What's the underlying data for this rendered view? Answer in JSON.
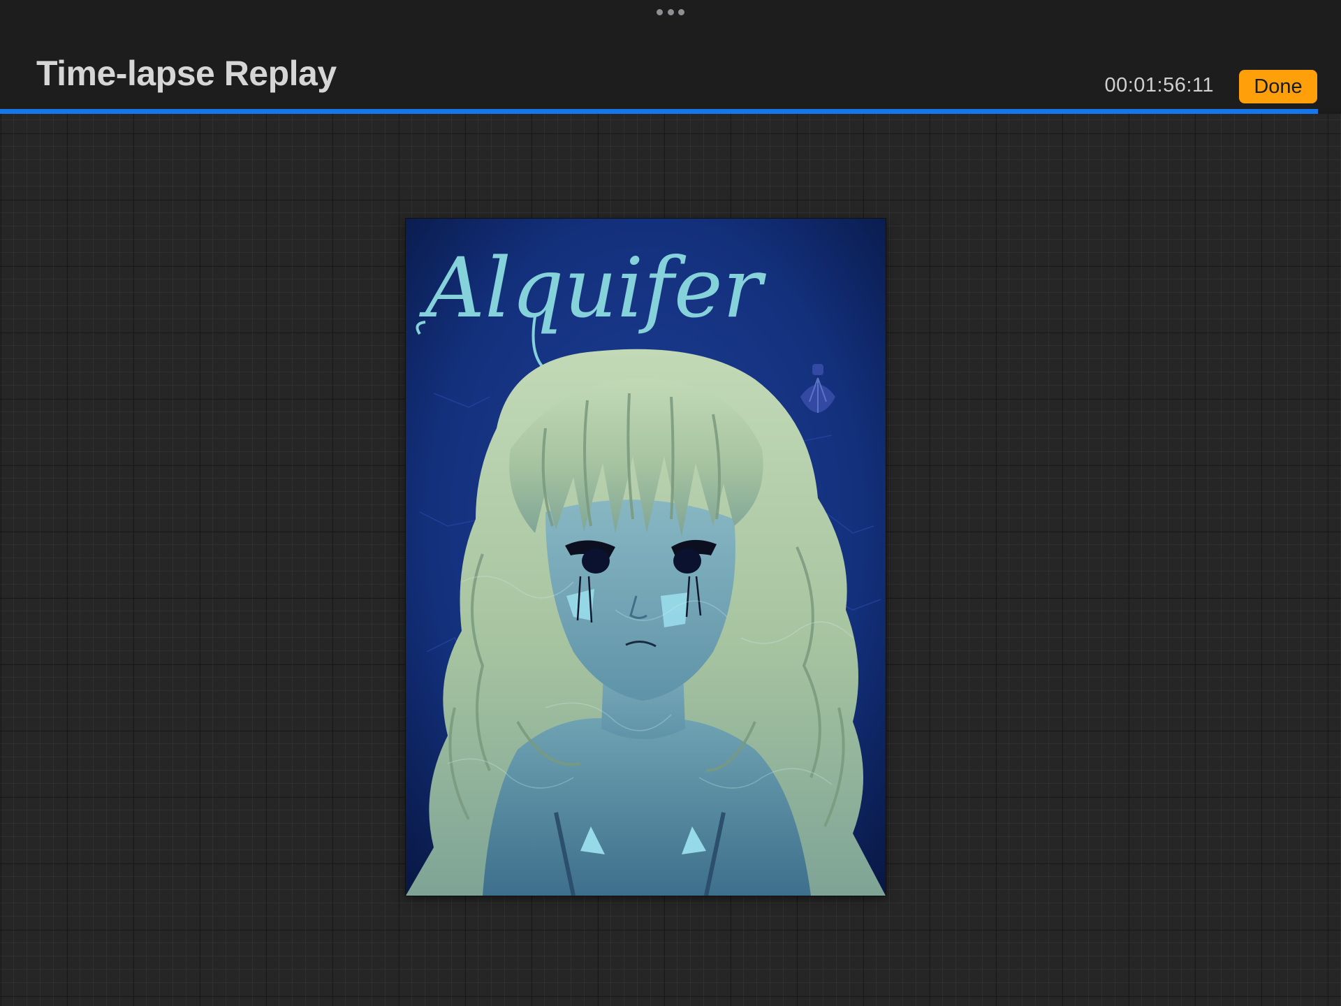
{
  "header": {
    "title": "Time-lapse Replay",
    "elapsed_time": "00:01:56:11",
    "done_label": "Done",
    "more_icon": "ellipsis-icon"
  },
  "playback": {
    "progress": 0.983,
    "progress_color": "#1677ea"
  },
  "canvas": {
    "artwork_title": "Alquifer",
    "background_color": "#0d1f5a",
    "hair_color": "#a9c6a2"
  },
  "colors": {
    "accent_done": "#ff9f0a",
    "toolbar": "#1d1d1e",
    "workspace": "#262626",
    "title_text": "#d6d6d6"
  }
}
